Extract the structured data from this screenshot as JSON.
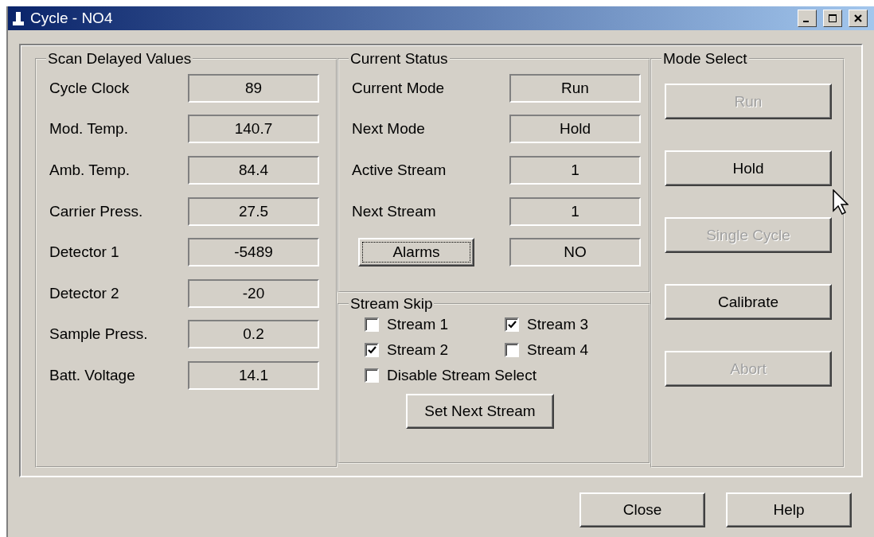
{
  "window": {
    "title": "Cycle - NO4"
  },
  "scan_delayed_values": {
    "title": "Scan Delayed Values",
    "rows": [
      {
        "label": "Cycle Clock",
        "value": "89"
      },
      {
        "label": "Mod. Temp.",
        "value": "140.7"
      },
      {
        "label": "Amb. Temp.",
        "value": "84.4"
      },
      {
        "label": "Carrier Press.",
        "value": "27.5"
      },
      {
        "label": "Detector 1",
        "value": "-5489"
      },
      {
        "label": "Detector 2",
        "value": "-20"
      },
      {
        "label": "Sample Press.",
        "value": "0.2"
      },
      {
        "label": "Batt. Voltage",
        "value": "14.1"
      }
    ]
  },
  "current_status": {
    "title": "Current Status",
    "rows": [
      {
        "kind": "label",
        "label": "Current Mode",
        "value": "Run"
      },
      {
        "kind": "label",
        "label": "Next Mode",
        "value": "Hold"
      },
      {
        "kind": "label",
        "label": "Active Stream",
        "value": "1"
      },
      {
        "kind": "label",
        "label": "Next Stream",
        "value": "1"
      },
      {
        "kind": "button",
        "label": "Alarms",
        "value": "NO",
        "focused": true
      }
    ]
  },
  "stream_skip": {
    "title": "Stream Skip",
    "streams": [
      {
        "label": "Stream 1",
        "checked": false
      },
      {
        "label": "Stream 3",
        "checked": true
      },
      {
        "label": "Stream 2",
        "checked": true
      },
      {
        "label": "Stream 4",
        "checked": false
      }
    ],
    "disable_stream_select": {
      "label": "Disable Stream Select",
      "checked": false
    },
    "button": "Set Next Stream"
  },
  "mode_select": {
    "title": "Mode Select",
    "buttons": [
      {
        "label": "Run",
        "disabled": true
      },
      {
        "label": "Hold",
        "disabled": false
      },
      {
        "label": "Single Cycle",
        "disabled": true
      },
      {
        "label": "Calibrate",
        "disabled": false
      },
      {
        "label": "Abort",
        "disabled": true
      }
    ]
  },
  "footer_buttons": [
    {
      "label": "Close"
    },
    {
      "label": "Help"
    }
  ]
}
